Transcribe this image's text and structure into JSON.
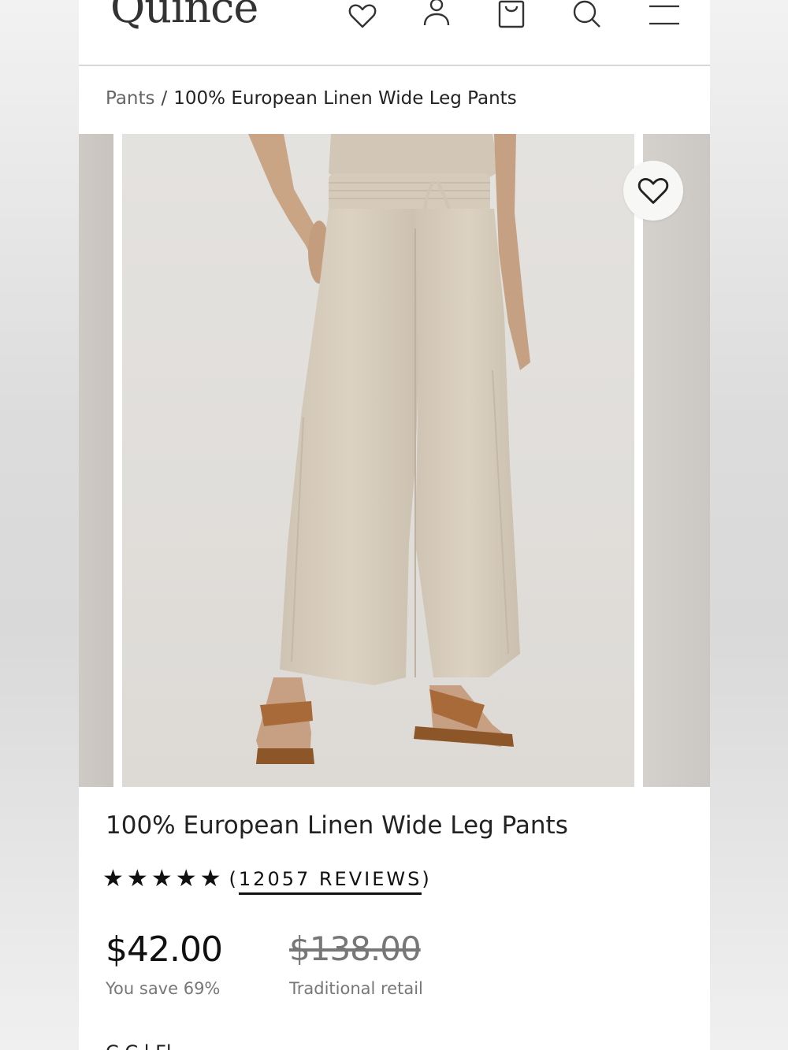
{
  "header": {
    "logo": "Quince",
    "icons": [
      "heart-icon",
      "account-icon",
      "bag-icon",
      "search-icon",
      "menu-icon"
    ]
  },
  "breadcrumb": {
    "parent": "Pants",
    "separator": "/",
    "current": "100% European Linen Wide Leg Pants"
  },
  "product": {
    "title": "100% European Linen Wide Leg Pants",
    "rating": 5,
    "reviews_open": "(",
    "reviews_label": "12057 REVIEWS",
    "reviews_close": ")",
    "price": "$42.00",
    "savings": "You save 69%",
    "traditional_price": "$138.00",
    "traditional_label": "Traditional retail",
    "next_section_partial": "C    C l   Fl"
  },
  "colors": {
    "pants": "#d3c8b8",
    "sandals": "#a86a38",
    "photo_bg": "#e3e1de"
  }
}
